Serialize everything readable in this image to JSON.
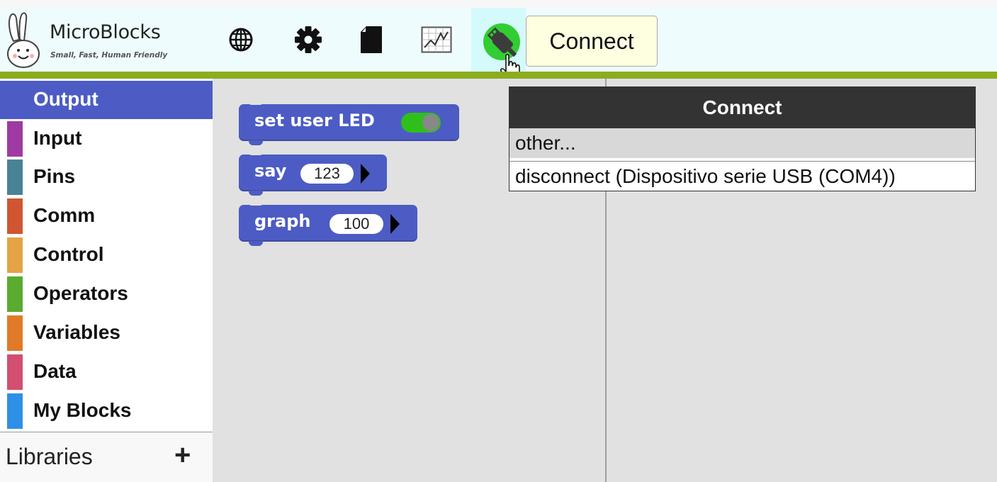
{
  "app": {
    "name": "MicroBlocks",
    "tagline": "Small, Fast, Human Friendly"
  },
  "toolbar": {
    "icons": [
      "globe-icon",
      "gear-icon",
      "file-icon",
      "graph-icon",
      "usb-connect-icon"
    ],
    "tooltip": "Connect",
    "accent_line_color": "#8cac20"
  },
  "categories": [
    {
      "label": "Output",
      "color": "#4c5cc4",
      "selected": true
    },
    {
      "label": "Input",
      "color": "#a03aa3"
    },
    {
      "label": "Pins",
      "color": "#4a8295"
    },
    {
      "label": "Comm",
      "color": "#d05530"
    },
    {
      "label": "Control",
      "color": "#e4a345"
    },
    {
      "label": "Operators",
      "color": "#5aab2f"
    },
    {
      "label": "Variables",
      "color": "#e07a28"
    },
    {
      "label": "Data",
      "color": "#d24f72"
    },
    {
      "label": "My Blocks",
      "color": "#2e8fe6"
    }
  ],
  "libraries": {
    "label": "Libraries",
    "add": "+"
  },
  "palette": {
    "blocks": [
      {
        "label": "set user LED",
        "toggle": true
      },
      {
        "label": "say",
        "arg": "123"
      },
      {
        "label": "graph",
        "arg": "100"
      }
    ]
  },
  "connect_menu": {
    "title": "Connect",
    "items": [
      "other...",
      "disconnect (Dispositivo serie USB (COM4))"
    ]
  }
}
